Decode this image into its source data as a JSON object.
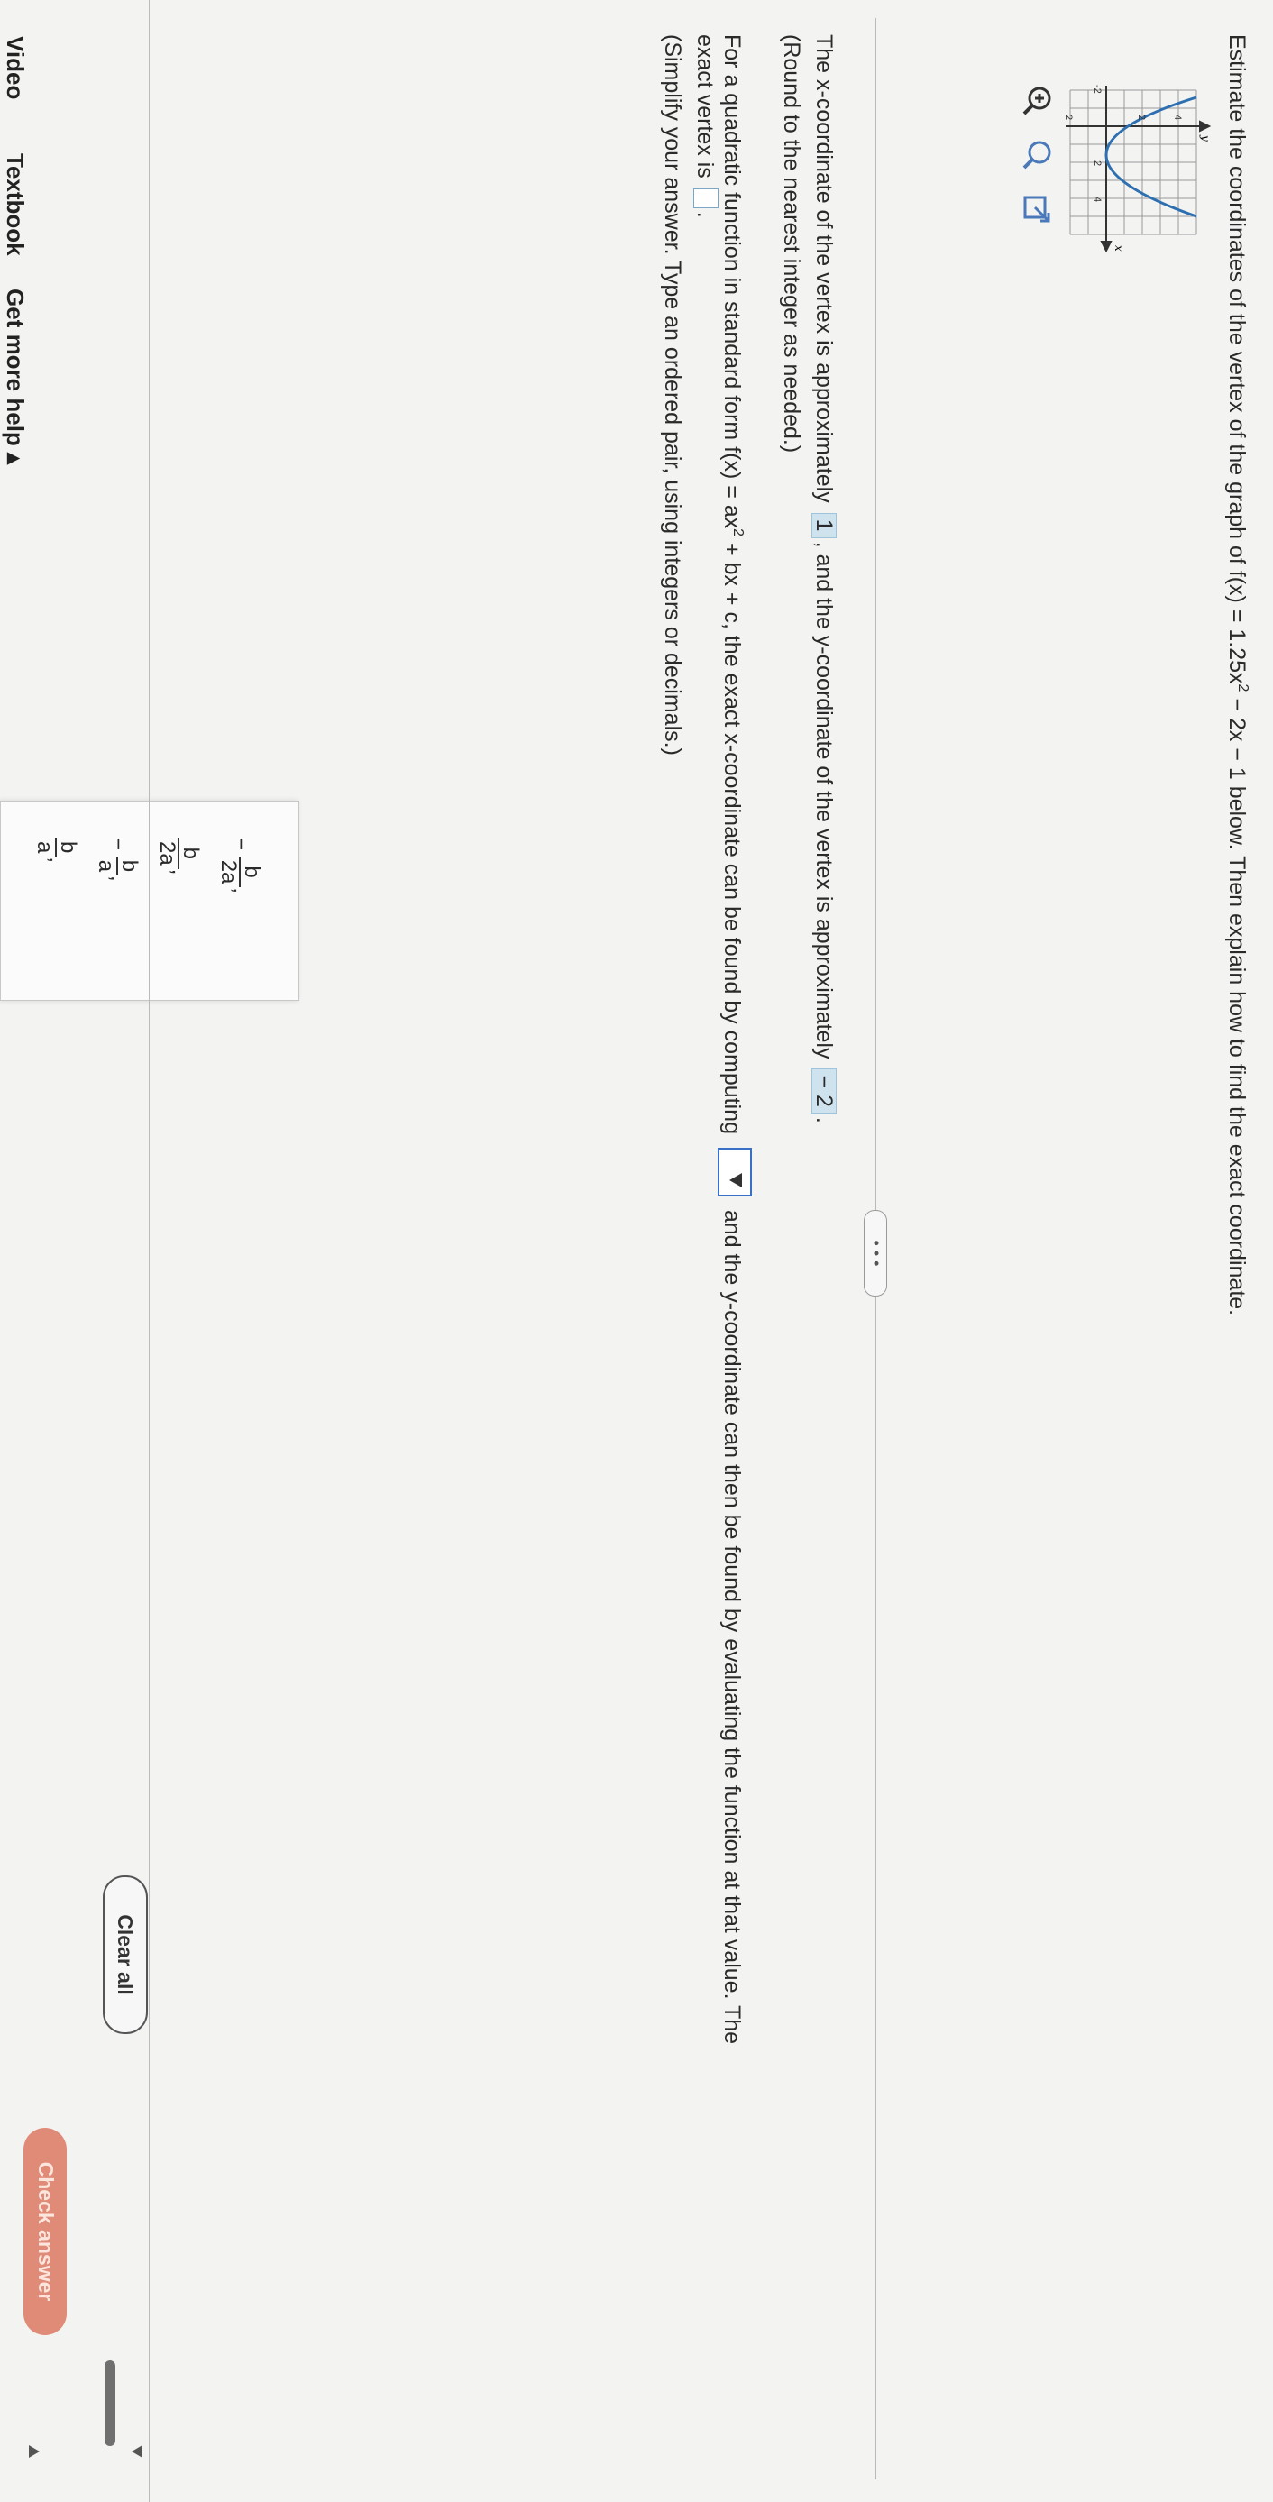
{
  "question": {
    "prompt_before": "Estimate the coordinates of the vertex of the graph of f(x) = 1.25x",
    "prompt_exp": "2",
    "prompt_after": " − 2x − 1 below. Then explain how to find the exact coordinate."
  },
  "graph": {
    "axis_x_label": "x",
    "axis_y_label": "y",
    "tick_labels": [
      "-2",
      "2",
      "4",
      "2",
      "4",
      "2"
    ]
  },
  "tools": [
    "zoom-in-icon",
    "zoom-out-icon",
    "popout-icon"
  ],
  "part1": {
    "line1_before": "The x-coordinate of the vertex is approximately",
    "x_answer": "1",
    "line1_middle": ", and the y-coordinate of the vertex is approximately",
    "y_answer": "− 2",
    "line1_end": ".",
    "hint": "(Round to the nearest integer as needed.)"
  },
  "part2": {
    "line_before": "For a quadratic function in standard form f(x) = ax",
    "line_exp": "2",
    "line_mid": " + bx + c, the exact x-coordinate can be found by computing",
    "line_after": "and the y-coordinate can then be found by evaluating the function at that value. The",
    "line2": "exact vertex is",
    "line2_end": ".",
    "hint": "(Simplify your answer. Type an ordered pair, using integers or decimals.)"
  },
  "expander_dots": "• • •",
  "dropdown_options": [
    {
      "sign": "−",
      "num": "b",
      "den": "2a",
      "suffix": ","
    },
    {
      "sign": "",
      "num": "b",
      "den": "2a",
      "suffix": ","
    },
    {
      "sign": "−",
      "num": "b",
      "den": "a",
      "suffix": ","
    },
    {
      "sign": "",
      "num": "b",
      "den": "a",
      "suffix": ","
    }
  ],
  "buttons": {
    "clear": "Clear all",
    "check": "Check answer"
  },
  "footer": {
    "video": "Video",
    "textbook": "Textbook",
    "help": "Get more help ▴"
  },
  "colors": {
    "answer_box": "#cfe3ee",
    "select_border": "#3a6fc7",
    "check_button": "#e08a78"
  }
}
